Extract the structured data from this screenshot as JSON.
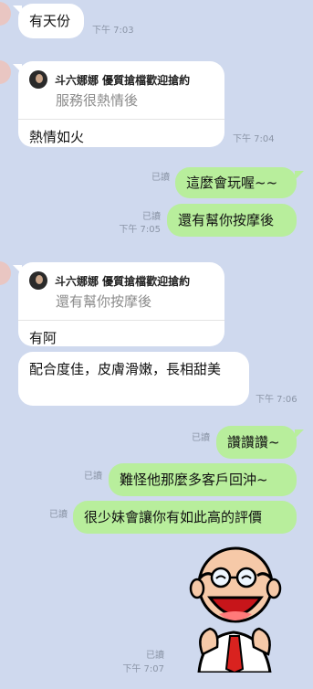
{
  "messages": {
    "m1": {
      "text": "有天份",
      "time": "下午 7:03"
    },
    "m2": {
      "quote_author": "斗六娜娜 優質搶檔歡迎搶約",
      "quote_text": "服務很熱情後",
      "text": "熱情如火",
      "time": "下午 7:04"
    },
    "m3": {
      "read": "已讀",
      "text": "這麼會玩喔~~"
    },
    "m4": {
      "read": "已讀",
      "time": "下午 7:05",
      "text": "還有幫你按摩後"
    },
    "m5": {
      "quote_author": "斗六娜娜 優質搶檔歡迎搶約",
      "quote_text": "還有幫你按摩後",
      "text": "有阿"
    },
    "m6": {
      "text": "配合度佳，皮膚滑嫩，長相甜美",
      "time": "下午 7:06"
    },
    "m7": {
      "read": "已讀",
      "text": "讚讚讚~"
    },
    "m8": {
      "read": "已讀",
      "text": "難怪他那麼多客戶回沖~"
    },
    "m9": {
      "read": "已讀",
      "text": "很少妹會讓你有如此高的評價"
    },
    "m10": {
      "read": "已讀",
      "time": "下午 7:07",
      "sticker": "bald-man-laughing-sticker"
    }
  },
  "colors": {
    "background": "#cfd9ee",
    "incoming": "#ffffff",
    "outgoing": "#b8ee9c"
  }
}
